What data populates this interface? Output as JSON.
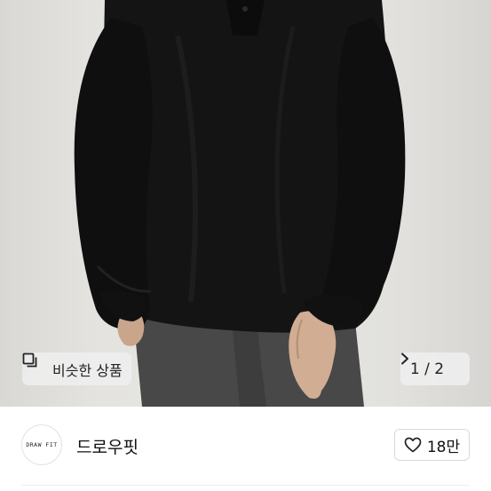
{
  "gallery": {
    "similar_label": "비슷한 상품",
    "counter": "1 / 2",
    "icons": {
      "similar": "copy-icon",
      "next": "chevron-right-icon"
    }
  },
  "seller": {
    "logo_text": "DRAW FIT",
    "name": "드로우핏",
    "like_count": "18만",
    "like_icon": "heart-outline-icon"
  }
}
